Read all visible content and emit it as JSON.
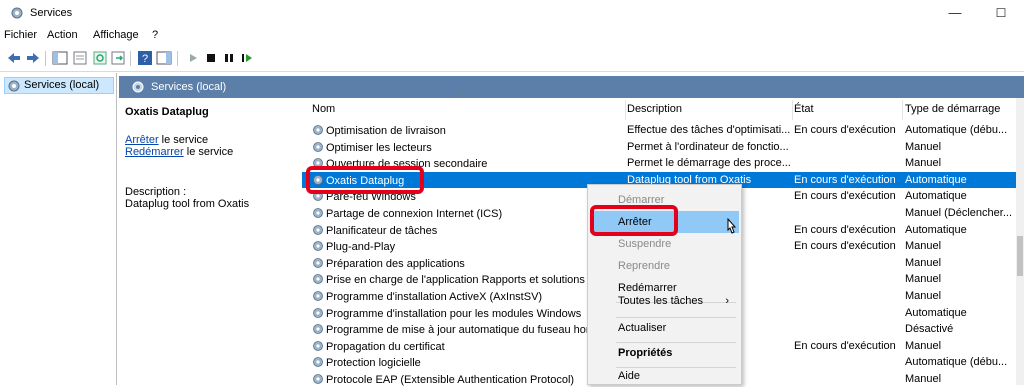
{
  "window": {
    "title": "Services",
    "minimize": "—",
    "maximize": "☐",
    "close": "✕"
  },
  "menu": [
    "Fichier",
    "Action",
    "Affichage",
    "?"
  ],
  "tree": {
    "item": "Services (local)"
  },
  "panel": {
    "header": "Services (local)",
    "service_name": "Oxatis Dataplug",
    "stop_link": "Arrêter",
    "stop_suffix": " le service",
    "restart_link": "Redémarrer",
    "restart_suffix": " le service",
    "description_label": "Description :",
    "description_value": "Dataplug tool from Oxatis"
  },
  "columns": {
    "name": "Nom",
    "description": "Description",
    "state": "État",
    "startup": "Type de démarrage"
  },
  "rows": [
    {
      "name": "Optimisation de livraison",
      "description": "Effectue des tâches d'optimisati...",
      "state": "En cours d'exécution",
      "startup": "Automatique (débu..."
    },
    {
      "name": "Optimiser les lecteurs",
      "description": "Permet à l'ordinateur de fonctio...",
      "state": "",
      "startup": "Manuel"
    },
    {
      "name": "Ouverture de session secondaire",
      "description": "Permet le démarrage des proce...",
      "state": "",
      "startup": "Manuel"
    },
    {
      "name": "Oxatis Dataplug",
      "description": "Dataplug tool from Oxatis",
      "state": "En cours d'exécution",
      "startup": "Automatique"
    },
    {
      "name": "Pare-feu Windows",
      "description": "us aide ...",
      "state": "En cours d'exécution",
      "startup": "Automatique"
    },
    {
      "name": "Partage de connexion Internet (ICS)",
      "description": "resses ...",
      "state": "",
      "startup": "Manuel (Déclencher..."
    },
    {
      "name": "Planificateur de tâches",
      "description": "e confi...",
      "state": "En cours d'exécution",
      "startup": "Automatique"
    },
    {
      "name": "Plug-and-Play",
      "description": "reconn...",
      "state": "En cours d'exécution",
      "startup": "Manuel"
    },
    {
      "name": "Préparation des applications",
      "description": "pour la ...",
      "state": "",
      "startup": "Manuel"
    },
    {
      "name": "Prise en charge de l'application Rapports et solutions au",
      "description": "ge l'affi...",
      "state": "",
      "startup": "Manuel"
    },
    {
      "name": "Programme d'installation ActiveX (AxInstSV)",
      "description": "npte d'...",
      "state": "",
      "startup": "Manuel"
    },
    {
      "name": "Programme d'installation pour les modules Windows",
      "description": "nodific...",
      "state": "",
      "startup": "Automatique"
    },
    {
      "name": "Programme de mise à jour automatique du fuseau horai",
      "description": "t le fus...",
      "state": "",
      "startup": "Désactivé"
    },
    {
      "name": "Propagation du certificat",
      "description": "sateur ...",
      "state": "En cours d'exécution",
      "startup": "Manuel"
    },
    {
      "name": "Protection logicielle",
      "description": "t, l'inst...",
      "state": "",
      "startup": "Automatique (débu..."
    },
    {
      "name": "Protocole EAP (Extensible Authentication Protocol)",
      "description": "e Auth...",
      "state": "",
      "startup": "Manuel"
    }
  ],
  "context_menu": {
    "start": "Démarrer",
    "stop": "Arrêter",
    "pause": "Suspendre",
    "resume": "Reprendre",
    "restart": "Redémarrer",
    "all_tasks": "Toutes les tâches",
    "all_tasks_arrow": "›",
    "refresh": "Actualiser",
    "properties": "Propriétés",
    "help": "Aide"
  },
  "colors": {
    "accent": "#0078d7",
    "highlight": "#e3001b",
    "header": "#5b7fa8"
  }
}
